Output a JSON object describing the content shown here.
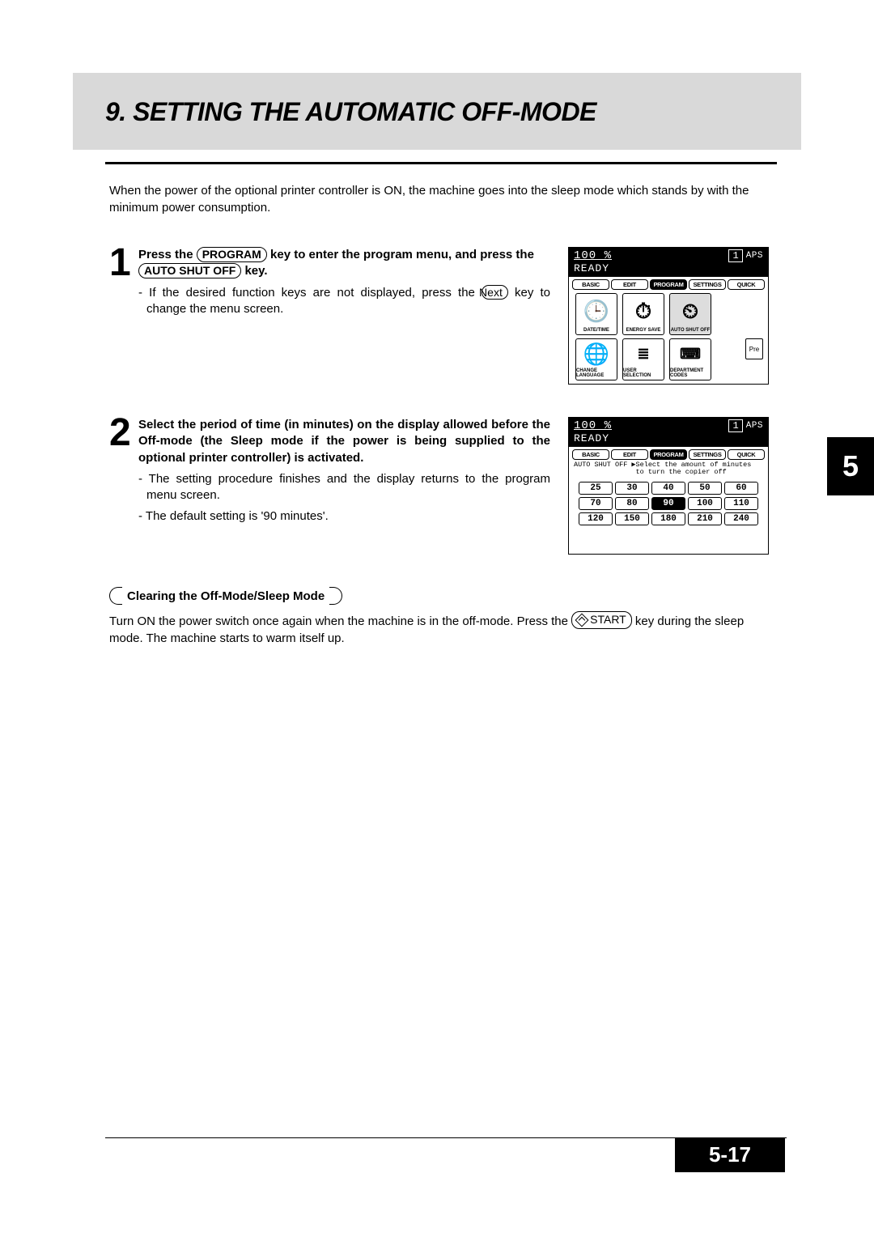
{
  "title": "9. SETTING THE AUTOMATIC OFF-MODE",
  "intro": "When the power of the optional printer controller is ON, the machine goes into the sleep mode which stands by with the minimum power consumption.",
  "chapterTab": "5",
  "pageNumber": "5-17",
  "step1": {
    "textA": "Press the ",
    "key1": "PROGRAM",
    "textB": " key to enter the program menu, and press the ",
    "key2": "AUTO SHUT OFF",
    "textC": " key.",
    "sub1a": "If the desired function keys are not displayed, press the ",
    "subKey": "Next",
    "sub1b": " key to change the menu screen."
  },
  "step2": {
    "bold": "Select the period of time (in minutes) on the display allowed before the Off-mode (the Sleep mode if the power is being supplied to the optional printer controller) is activated.",
    "sub1": "The setting procedure finishes and the display returns to the program menu screen.",
    "sub2": "The default setting is '90 minutes'."
  },
  "clearing": {
    "heading": "Clearing the Off-Mode/Sleep Mode",
    "bodyA": "Turn ON the power switch once again when the machine is in the off-mode. Press the ",
    "key": "START",
    "bodyB": " key during the sleep mode. The machine starts to warm itself up."
  },
  "display": {
    "zoom": "100  %",
    "ready": "READY",
    "counter": "1",
    "aps": "APS",
    "tabs": [
      "BASIC",
      "EDIT",
      "PROGRAM",
      "SETTINGS",
      "QUICK"
    ],
    "activeTab": 2,
    "preBtn": "Pre",
    "icons": [
      "DATE/TIME",
      "ENERGY SAVE",
      "AUTO SHUT OFF",
      "CHANGE LANGUAGE",
      "USER SELECTION",
      "DEPARTMENT CODES"
    ],
    "prompt": "AUTO SHUT OFF ▶Select the amount of minutes\n               to turn the copier off"
  },
  "chart_data": {
    "type": "table",
    "title": "Auto Shut Off time options (minutes)",
    "values": [
      25,
      30,
      40,
      50,
      60,
      70,
      80,
      90,
      100,
      110,
      120,
      150,
      180,
      210,
      240
    ],
    "selected": 90,
    "default": 90,
    "units": "minutes"
  }
}
